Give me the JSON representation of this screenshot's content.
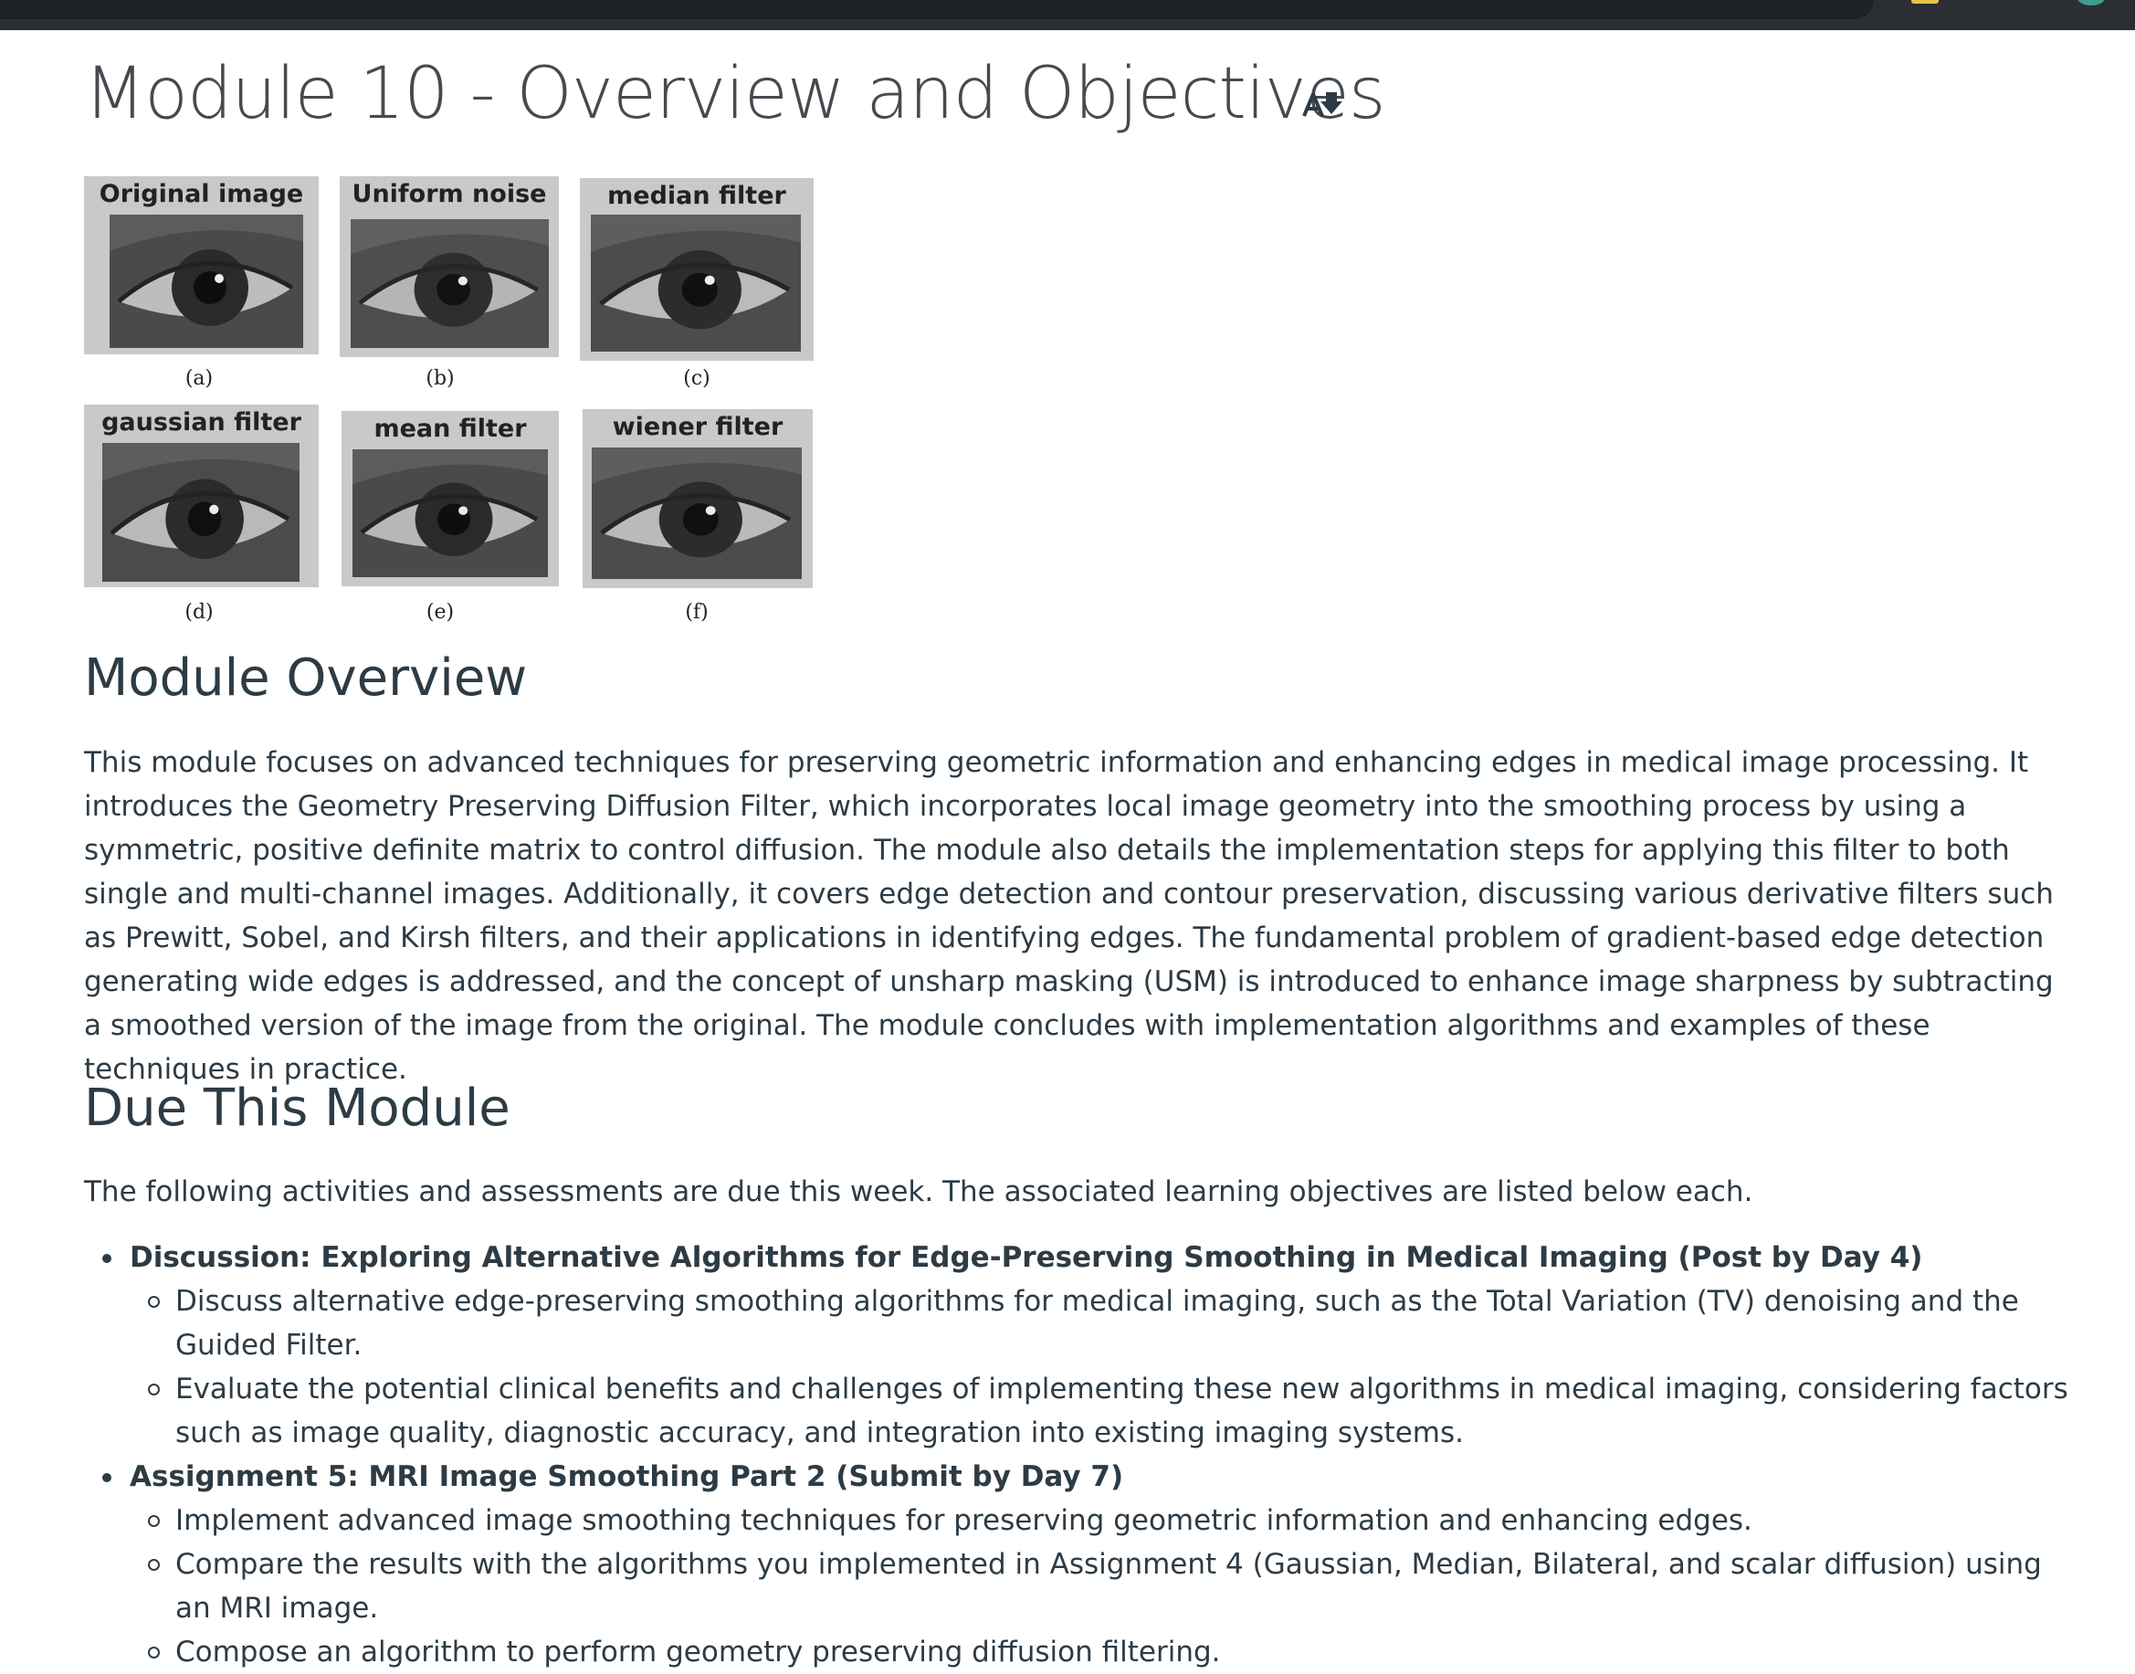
{
  "page": {
    "title": "Module 10 - Overview and Objectives"
  },
  "figure": {
    "panels": [
      {
        "label": "Original image",
        "caption": "(a)"
      },
      {
        "label": "Uniform noise",
        "caption": "(b)"
      },
      {
        "label": "median filter",
        "caption": "(c)"
      },
      {
        "label": "gaussian filter",
        "caption": "(d)"
      },
      {
        "label": "mean filter",
        "caption": "(e)"
      },
      {
        "label": "wiener filter",
        "caption": "(f)"
      }
    ]
  },
  "overview": {
    "heading": "Module Overview",
    "body": "This module focuses on advanced techniques for preserving geometric information and enhancing edges in medical image processing. It introduces the Geometry Preserving Diffusion Filter, which incorporates local image geometry into the smoothing process by using a symmetric, positive definite matrix to control diffusion. The module also details the implementation steps for applying this filter to both single and multi-channel images. Additionally, it covers edge detection and contour preservation, discussing various derivative filters such as Prewitt, Sobel, and Kirsh filters, and their applications in identifying edges. The fundamental problem of gradient-based edge detection generating wide edges is addressed, and the concept of unsharp masking (USM) is introduced to enhance image sharpness by subtracting a smoothed version of the image from the original. The module concludes with implementation algorithms and examples of these techniques in practice."
  },
  "due": {
    "heading": "Due This Module",
    "intro": "The following activities and assessments are due this week. The associated learning objectives are listed below each.",
    "items": [
      {
        "title": "Discussion: Exploring Alternative Algorithms for Edge-Preserving Smoothing in Medical Imaging (Post by Day 4)",
        "objectives": [
          "Discuss alternative edge-preserving smoothing algorithms for medical imaging, such as the Total Variation (TV) denoising and the Guided Filter.",
          "Evaluate the potential clinical benefits and challenges of implementing these new algorithms in medical imaging, considering factors such as image quality, diagnostic accuracy, and integration into existing imaging systems."
        ]
      },
      {
        "title": "Assignment 5: MRI Image Smoothing Part 2 (Submit by Day 7)",
        "objectives": [
          "Implement advanced image smoothing techniques for preserving geometric information and enhancing edges.",
          "Compare the results with the algorithms you implemented in Assignment 4 (Gaussian, Median, Bilateral, and scalar diffusion) using an MRI image.",
          "Compose an algorithm to perform geometry preserving diffusion filtering."
        ]
      }
    ]
  },
  "icons": {
    "immersive_reader": "immersive-reader-icon"
  },
  "colors": {
    "text": "#2d3b45",
    "title": "#454a50",
    "topbar": "#2b2e33"
  }
}
